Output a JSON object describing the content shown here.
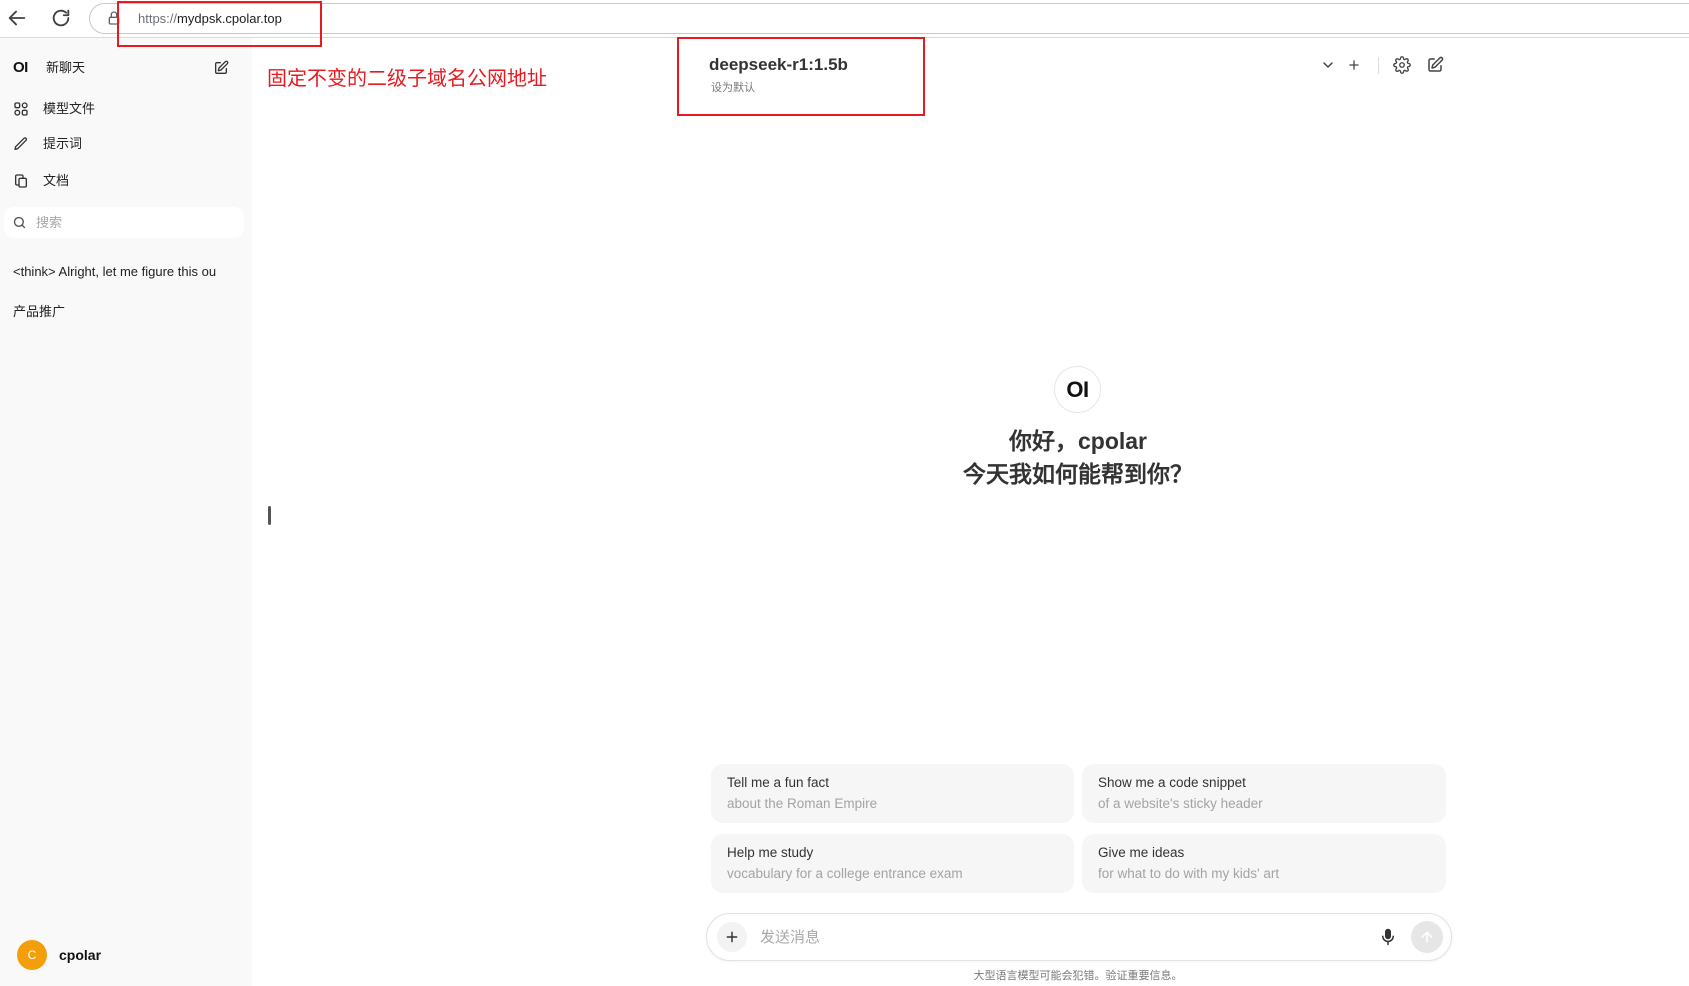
{
  "browser": {
    "url_scheme": "https://",
    "url_host": "mydpsk.cpolar.top",
    "icons": [
      "arrow-left-icon",
      "refresh-icon",
      "lock-icon"
    ]
  },
  "annotation": {
    "label": "固定不变的二级子域名公网地址"
  },
  "sidebar": {
    "logo": "OI",
    "new_chat_label": "新聊天",
    "nav": [
      {
        "label": "模型文件",
        "icon": "grid-icon"
      },
      {
        "label": "提示词",
        "icon": "pencil-icon"
      },
      {
        "label": "文档",
        "icon": "copy-icon"
      }
    ],
    "search": {
      "placeholder": "搜索",
      "icon": "search-icon"
    },
    "chats": [
      {
        "title": "<think> Alright, let me figure this ou"
      },
      {
        "title": "产品推广"
      }
    ],
    "user": {
      "avatar_initial": "C",
      "name": "cpolar"
    }
  },
  "header": {
    "model_name": "deepseek-r1:1.5b",
    "set_default": "设为默认",
    "icons": [
      "chevron-down-icon",
      "plus-icon",
      "gear-icon",
      "compose-icon"
    ]
  },
  "welcome": {
    "logo": "OI",
    "greeting": "你好，cpolar",
    "subtitle": "今天我如何能帮到你？"
  },
  "suggestions": [
    {
      "title": "Tell me a fun fact",
      "subtitle": "about the Roman Empire"
    },
    {
      "title": "Show me a code snippet",
      "subtitle": "of a website's sticky header"
    },
    {
      "title": "Help me study",
      "subtitle": "vocabulary for a college entrance exam"
    },
    {
      "title": "Give me ideas",
      "subtitle": "for what to do with my kids' art"
    }
  ],
  "composer": {
    "placeholder": "发送消息",
    "icons": [
      "plus-icon",
      "microphone-icon",
      "arrow-up-icon"
    ]
  },
  "disclaimer": "大型语言模型可能会犯错。验证重要信息。",
  "colors": {
    "annotation_red": "#e8191f",
    "avatar": "#f59e0b",
    "sidebar_bg": "#f9f9f9",
    "card_bg": "#f6f6f6"
  }
}
